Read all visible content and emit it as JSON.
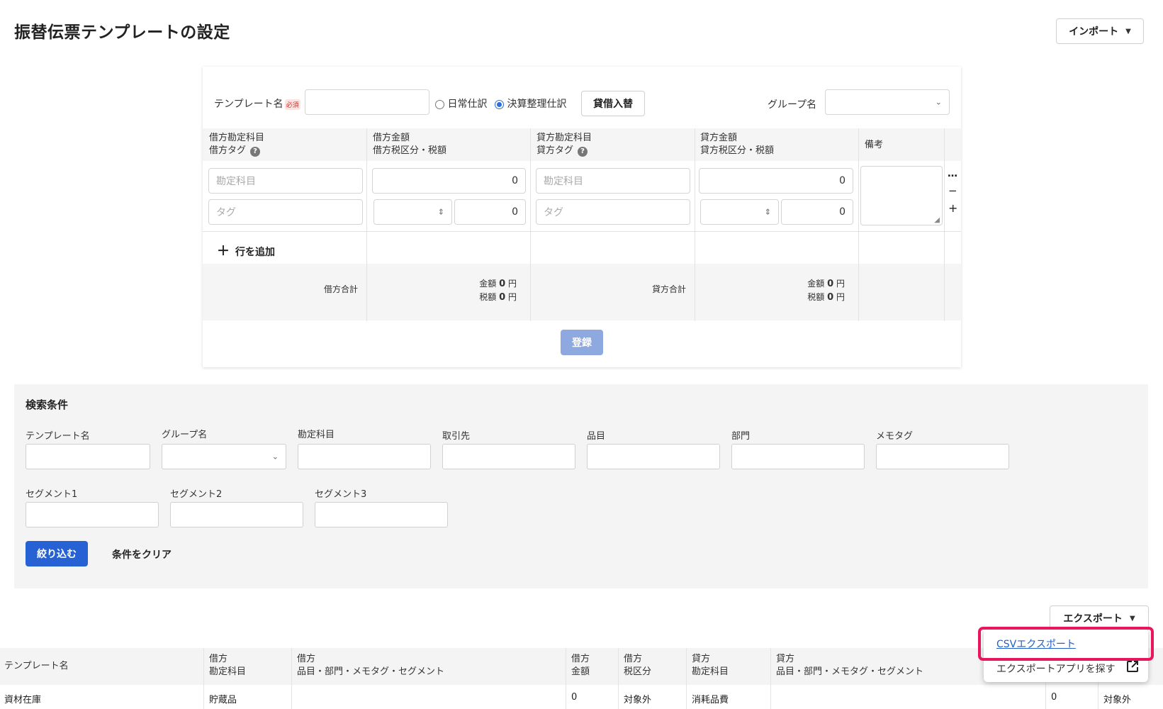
{
  "page_title": "振替伝票テンプレートの設定",
  "import_button": "インポート",
  "form": {
    "template_name_label": "テンプレート名",
    "required_badge": "必須",
    "radio_daily": "日常仕訳",
    "radio_closing": "決算整理仕訳",
    "radio_selected": "決算整理仕訳",
    "swap_button": "貸借入替",
    "group_label": "グループ名",
    "headers": {
      "debit_account_1": "借方勘定科目",
      "debit_account_2": "借方タグ",
      "debit_amount_1": "借方金額",
      "debit_amount_2": "借方税区分・税額",
      "credit_account_1": "貸方勘定科目",
      "credit_account_2": "貸方タグ",
      "credit_amount_1": "貸方金額",
      "credit_amount_2": "貸方税区分・税額",
      "note": "備考"
    },
    "row": {
      "account_placeholder": "勘定科目",
      "tag_placeholder": "タグ",
      "debit_amount": "0",
      "debit_tax": "0",
      "credit_amount": "0",
      "credit_tax": "0"
    },
    "row_actions": {
      "more": "…",
      "remove": "−",
      "add": "+"
    },
    "add_row": "行を追加",
    "totals": {
      "debit_total_label": "借方合計",
      "credit_total_label": "貸方合計",
      "amount_prefix": "金額",
      "tax_prefix": "税額",
      "debit_amount": "0",
      "debit_tax": "0",
      "credit_amount": "0",
      "credit_tax": "0",
      "yen": "円"
    },
    "register_button": "登録"
  },
  "search": {
    "title": "検索条件",
    "fields": {
      "template_name": "テンプレート名",
      "group_name": "グループ名",
      "account": "勘定科目",
      "partner": "取引先",
      "item": "品目",
      "department": "部門",
      "memo_tag": "メモタグ",
      "segment1": "セグメント1",
      "segment2": "セグメント2",
      "segment3": "セグメント3"
    },
    "filter_button": "絞り込む",
    "clear_button": "条件をクリア"
  },
  "export_button": "エクスポート",
  "export_menu": {
    "csv_export": "CSVエクスポート",
    "find_export_app": "エクスポートアプリを探す"
  },
  "table": {
    "headers": {
      "template_name": "テンプレート名",
      "debit": "借方",
      "account": "勘定科目",
      "detail": "品目・部門・メモタグ・セグメント",
      "amount": "金額",
      "tax_category": "税区分",
      "credit": "貸方"
    },
    "rows": [
      {
        "template_name": "資材在庫",
        "debit_account": "貯蔵品",
        "debit_amount": "0",
        "debit_tax_category": "対象外",
        "credit_account": "消耗品費",
        "credit_amount": "0",
        "credit_tax_category": "対象外"
      }
    ]
  }
}
